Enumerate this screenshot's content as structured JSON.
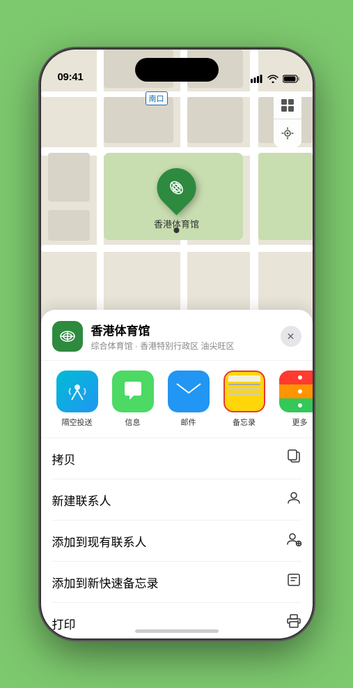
{
  "status_bar": {
    "time": "09:41",
    "signal_bars": "▌▌▌",
    "wifi": "wifi",
    "battery": "battery"
  },
  "map": {
    "label_text": "南口",
    "pin_label": "香港体育馆"
  },
  "map_controls": {
    "map_icon": "🗺",
    "location_icon": "↗"
  },
  "sheet": {
    "close_button": "✕",
    "venue_name": "香港体育馆",
    "venue_subtitle": "综合体育馆 · 香港特别行政区 油尖旺区",
    "apps": [
      {
        "id": "airdrop",
        "label": "隔空投送"
      },
      {
        "id": "messages",
        "label": "信息"
      },
      {
        "id": "mail",
        "label": "邮件"
      },
      {
        "id": "notes",
        "label": "备忘录",
        "highlighted": true
      },
      {
        "id": "more",
        "label": "更多"
      }
    ],
    "actions": [
      {
        "id": "copy",
        "label": "拷贝",
        "icon": "copy"
      },
      {
        "id": "new-contact",
        "label": "新建联系人",
        "icon": "person"
      },
      {
        "id": "add-contact",
        "label": "添加到现有联系人",
        "icon": "person-add"
      },
      {
        "id": "quick-note",
        "label": "添加到新快速备忘录",
        "icon": "note"
      },
      {
        "id": "print",
        "label": "打印",
        "icon": "print"
      }
    ]
  }
}
